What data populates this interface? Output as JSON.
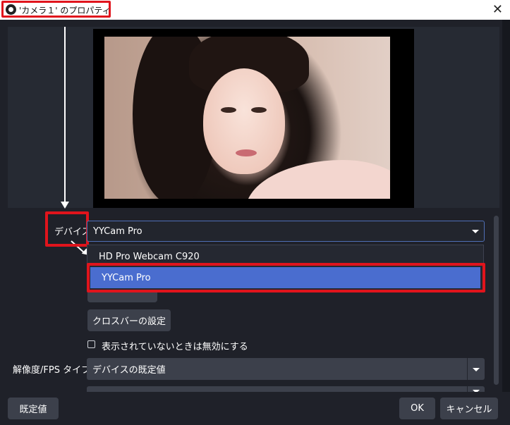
{
  "window": {
    "title": "'カメラ１' のプロパティ",
    "close_glyph": "✕"
  },
  "properties": {
    "device_label": "デバイス",
    "device_value": "YYCam Pro",
    "device_options": [
      "HD Pro Webcam C920",
      "YYCam Pro"
    ],
    "selected_option": "YYCam Pro",
    "crossbar_button": "クロスバーの設定",
    "disable_when_hidden_label": "表示されていないときは無効にする",
    "disable_when_hidden_checked": false,
    "resolution_label": "解像度/FPS タイプ",
    "resolution_value": "デバイスの既定値"
  },
  "footer": {
    "defaults_button": "既定値",
    "ok_button": "OK",
    "cancel_button": "キャンセル"
  },
  "icons": {
    "app_icon": "obs-logo-icon",
    "dropdown_icon": "chevron-down-icon"
  },
  "colors": {
    "background": "#1f2129",
    "control": "#3c404b",
    "selection": "#4a6dcf",
    "highlight_box": "#e0141c"
  }
}
